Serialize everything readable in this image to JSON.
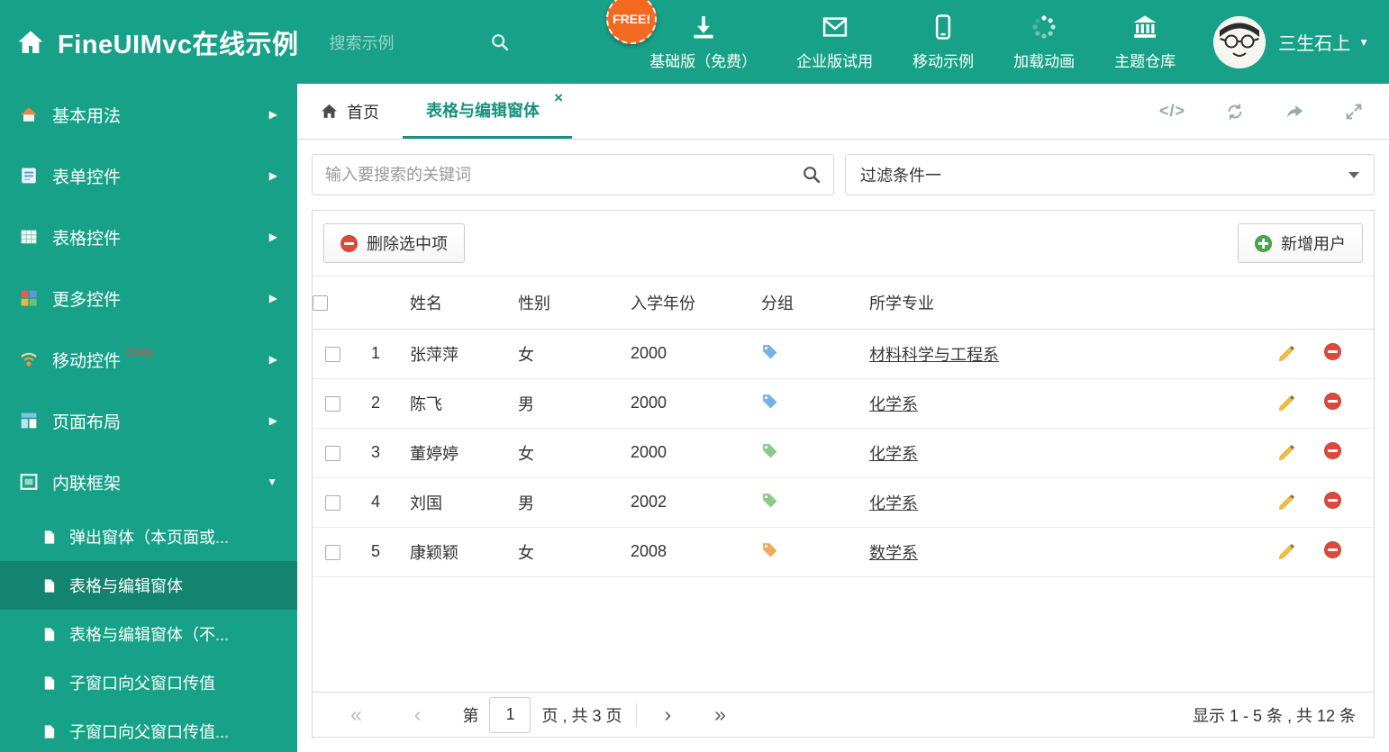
{
  "theme": {
    "accent": "#18a189",
    "danger": "#dd4a3b",
    "success": "#4aa74a"
  },
  "header": {
    "title": "FineUIMvc在线示例",
    "search_placeholder": "搜索示例",
    "free_badge": "FREE!",
    "nav": [
      {
        "label": "基础版（免费）",
        "icon": "download-icon"
      },
      {
        "label": "企业版试用",
        "icon": "envelope-icon"
      },
      {
        "label": "移动示例",
        "icon": "mobile-icon"
      },
      {
        "label": "加载动画",
        "icon": "spinner-icon"
      },
      {
        "label": "主题仓库",
        "icon": "bank-icon"
      }
    ],
    "user_name": "三生石上",
    "user_caret": "▼"
  },
  "sidebar": {
    "items": [
      {
        "label": "基本用法",
        "icon": "home-icon",
        "chevron": "▶"
      },
      {
        "label": "表单控件",
        "icon": "form-icon",
        "chevron": "▶"
      },
      {
        "label": "表格控件",
        "icon": "grid-icon",
        "chevron": "▶"
      },
      {
        "label": "更多控件",
        "icon": "widgets-icon",
        "chevron": "▶"
      },
      {
        "label": "移动控件",
        "badge": "Corp.",
        "icon": "wireless-icon",
        "chevron": "▶"
      },
      {
        "label": "页面布局",
        "icon": "layout-icon",
        "chevron": "▶"
      },
      {
        "label": "内联框架",
        "icon": "iframe-icon",
        "chevron": "▼"
      }
    ],
    "subitems": [
      {
        "label": "弹出窗体（本页面或..."
      },
      {
        "label": "表格与编辑窗体"
      },
      {
        "label": "表格与编辑窗体（不..."
      },
      {
        "label": "子窗口向父窗口传值"
      },
      {
        "label": "子窗口向父窗口传值..."
      }
    ]
  },
  "tabbar": {
    "home_tab": "首页",
    "active_tab": "表格与编辑窗体",
    "close_glyph": "×",
    "code_glyph": "</>"
  },
  "filters": {
    "search_placeholder": "输入要搜索的关键词",
    "filter_selected": "过滤条件一"
  },
  "toolbar": {
    "delete_label": "删除选中项",
    "add_label": "新增用户"
  },
  "table": {
    "headers": {
      "name": "姓名",
      "gender": "性别",
      "year": "入学年份",
      "group": "分组",
      "major": "所学专业"
    },
    "rows": [
      {
        "num": "1",
        "name": "张萍萍",
        "gender": "女",
        "year": "2000",
        "tag_color": "#74b3e3",
        "major": "材料科学与工程系"
      },
      {
        "num": "2",
        "name": "陈飞",
        "gender": "男",
        "year": "2000",
        "tag_color": "#74b3e3",
        "major": "化学系"
      },
      {
        "num": "3",
        "name": "董婷婷",
        "gender": "女",
        "year": "2000",
        "tag_color": "#8cc98c",
        "major": "化学系"
      },
      {
        "num": "4",
        "name": "刘国",
        "gender": "男",
        "year": "2002",
        "tag_color": "#8cc98c",
        "major": "化学系"
      },
      {
        "num": "5",
        "name": "康颖颖",
        "gender": "女",
        "year": "2008",
        "tag_color": "#f0a95e",
        "major": "数学系"
      }
    ]
  },
  "pagination": {
    "first_glyph": "«",
    "prev_glyph": "‹",
    "next_glyph": "›",
    "last_glyph": "»",
    "page_prefix": "第",
    "current_page": "1",
    "page_suffix": "页 , 共 3 页",
    "summary": "显示 1 - 5 条 , 共 12 条"
  }
}
